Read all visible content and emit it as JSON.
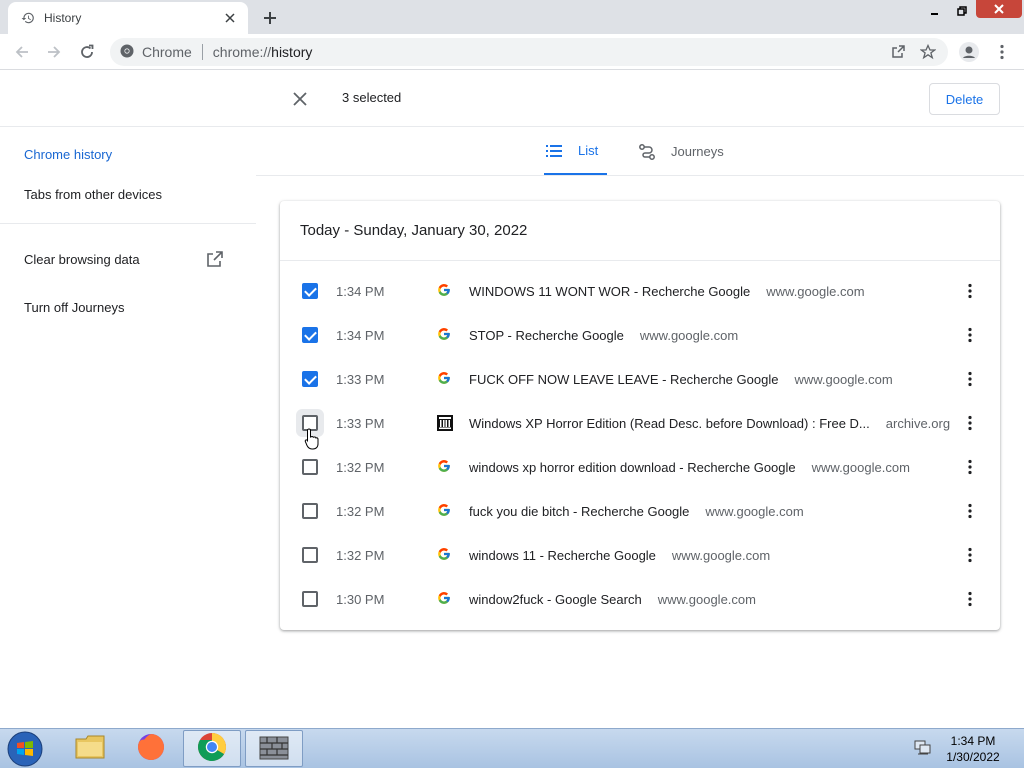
{
  "window": {
    "tab_title": "History",
    "new_tab_label": "+"
  },
  "toolbar": {
    "site_chip": "Chrome",
    "url_scheme": "chrome://",
    "url_path": "history"
  },
  "selection": {
    "count_label": "3 selected",
    "delete_label": "Delete"
  },
  "sidebar": {
    "items": [
      {
        "label": "Chrome history",
        "active": true
      },
      {
        "label": "Tabs from other devices",
        "active": false
      },
      {
        "label": "Clear browsing data",
        "active": false
      },
      {
        "label": "Turn off Journeys",
        "active": false
      }
    ]
  },
  "view_tabs": {
    "list_label": "List",
    "journeys_label": "Journeys"
  },
  "history": {
    "date_heading": "Today - Sunday, January 30, 2022",
    "entries": [
      {
        "checked": true,
        "time": "1:34 PM",
        "title": "WINDOWS 11 WONT WOR - Recherche Google",
        "domain": "www.google.com",
        "favicon": "google-icon"
      },
      {
        "checked": true,
        "time": "1:34 PM",
        "title": "STOP - Recherche Google",
        "domain": "www.google.com",
        "favicon": "google-icon"
      },
      {
        "checked": true,
        "time": "1:33 PM",
        "title": "FUCK OFF NOW LEAVE LEAVE - Recherche Google",
        "domain": "www.google.com",
        "favicon": "google-icon"
      },
      {
        "checked": false,
        "time": "1:33 PM",
        "title": "Windows XP Horror Edition (Read Desc. before Download) : Free D...",
        "domain": "archive.org",
        "favicon": "archive-icon"
      },
      {
        "checked": false,
        "time": "1:32 PM",
        "title": "windows xp horror edition download - Recherche Google",
        "domain": "www.google.com",
        "favicon": "google-icon"
      },
      {
        "checked": false,
        "time": "1:32 PM",
        "title": "fuck you die bitch - Recherche Google",
        "domain": "www.google.com",
        "favicon": "google-icon"
      },
      {
        "checked": false,
        "time": "1:32 PM",
        "title": "windows 11 - Recherche Google",
        "domain": "www.google.com",
        "favicon": "google-icon"
      },
      {
        "checked": false,
        "time": "1:30 PM",
        "title": "window2fuck - Google Search",
        "domain": "www.google.com",
        "favicon": "google-icon"
      }
    ]
  },
  "taskbar": {
    "clock_time": "1:34 PM",
    "clock_date": "1/30/2022"
  },
  "colors": {
    "accent": "#1a73e8",
    "tabstrip": "#dee1e6"
  }
}
